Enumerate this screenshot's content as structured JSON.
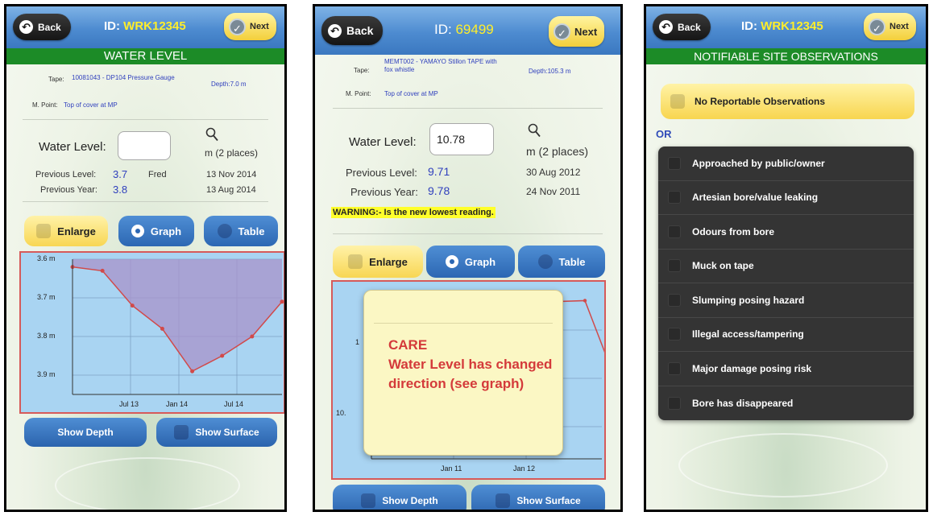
{
  "colors": {
    "nav_blue": "#4d8bd0",
    "section_green": "#1c8b27",
    "id_yellow": "#ffee2a",
    "value_blue": "#2f3fbd",
    "alert_red": "#d43a3a",
    "graph_fill": "#a9d4f2",
    "graph_line": "#d65a5a"
  },
  "icons": {
    "back": "back-arrow-icon",
    "next": "check-circle-icon",
    "lookup": "magnifier-icon",
    "checkbox": "checkbox-icon",
    "radio": "radio-icon"
  },
  "screens": [
    {
      "nav": {
        "back_label": "Back",
        "id_label": "ID:",
        "id_value": "WRK12345",
        "next_label": "Next"
      },
      "section_title": "WATER LEVEL",
      "site": {
        "tape_label": "Tape:",
        "tape_value": "10081043 - DP104 Pressure Gauge",
        "depth_text": "Depth:7.0 m",
        "mpoint_label": "M. Point:",
        "mpoint_value": "Top of cover at MP"
      },
      "water_level": {
        "label": "Water Level:",
        "value": "",
        "unit": "m (2 places)"
      },
      "previous": {
        "level_label": "Previous Level:",
        "level_value": "3.7",
        "level_by": "Fred",
        "level_date": "13 Nov 2014",
        "year_label": "Previous Year:",
        "year_value": "3.8",
        "year_date": "13 Aug 2014"
      },
      "buttons": {
        "enlarge": "Enlarge",
        "graph": "Graph",
        "table": "Table",
        "show_depth": "Show Depth",
        "show_surface": "Show Surface"
      },
      "chart_data": {
        "type": "area",
        "x": [
          "2013-03",
          "2013-05",
          "2013-08",
          "2013-12",
          "2014-03",
          "2014-06",
          "2014-09",
          "2014-12"
        ],
        "values": [
          3.62,
          3.63,
          3.72,
          3.78,
          3.89,
          3.85,
          3.8,
          3.71
        ],
        "y_tick_labels": [
          "3.6 m",
          "3.7 m",
          "3.8 m",
          "3.9 m"
        ],
        "y_ticks": [
          3.6,
          3.7,
          3.8,
          3.9
        ],
        "x_tick_labels": [
          "Jul 13",
          "Jan 14",
          "Jul 14"
        ],
        "ylim": [
          3.6,
          3.95
        ],
        "y_inverted": true,
        "grid": true
      }
    },
    {
      "nav": {
        "back_label": "Back",
        "id_label": "ID:",
        "id_value": "69499",
        "next_label": "Next"
      },
      "site": {
        "tape_label": "Tape:",
        "tape_value": "MEMT002 - YAMAYO Stillon TAPE with fox whistle",
        "depth_text": "Depth:105.3 m",
        "mpoint_label": "M. Point:",
        "mpoint_value": "Top of cover at MP"
      },
      "water_level": {
        "label": "Water Level:",
        "value": "10.78",
        "unit": "m (2 places)"
      },
      "previous": {
        "level_label": "Previous Level:",
        "level_value": "9.71",
        "level_date": "30 Aug 2012",
        "year_label": "Previous Year:",
        "year_value": "9.78",
        "year_date": "24 Nov 2011"
      },
      "warning": "WARNING:- Is the new lowest reading.",
      "buttons": {
        "enlarge": "Enlarge",
        "graph": "Graph",
        "table": "Table",
        "show_depth": "Show Depth",
        "show_surface": "Show Surface"
      },
      "popup": {
        "line1": "CARE",
        "line2": "Water Level has changed direction (see graph)"
      },
      "chart_data": {
        "type": "line",
        "x": [
          "2010-06",
          "2011-01",
          "2011-06",
          "2012-01",
          "2012-05",
          "2012-08",
          "2012-10",
          "2012-11"
        ],
        "values": [
          9.71,
          9.71,
          9.72,
          9.7,
          9.69,
          9.68,
          10.3,
          10.78
        ],
        "y_tick_labels": [
          "1",
          "10."
        ],
        "x_tick_labels": [
          "Jan 11",
          "Jan 12"
        ],
        "y_inverted": true,
        "grid": true
      }
    },
    {
      "nav": {
        "back_label": "Back",
        "id_label": "ID:",
        "id_value": "WRK12345",
        "next_label": "Next"
      },
      "section_title": "NOTIFIABLE SITE OBSERVATIONS",
      "no_reportable": "No Reportable Observations",
      "or_label": "OR",
      "observations": [
        "Approached by public/owner",
        "Artesian bore/value leaking",
        "Odours from bore",
        "Muck on tape",
        "Slumping posing hazard",
        "Illegal access/tampering",
        "Major damage posing risk",
        "Bore has disappeared"
      ]
    }
  ]
}
